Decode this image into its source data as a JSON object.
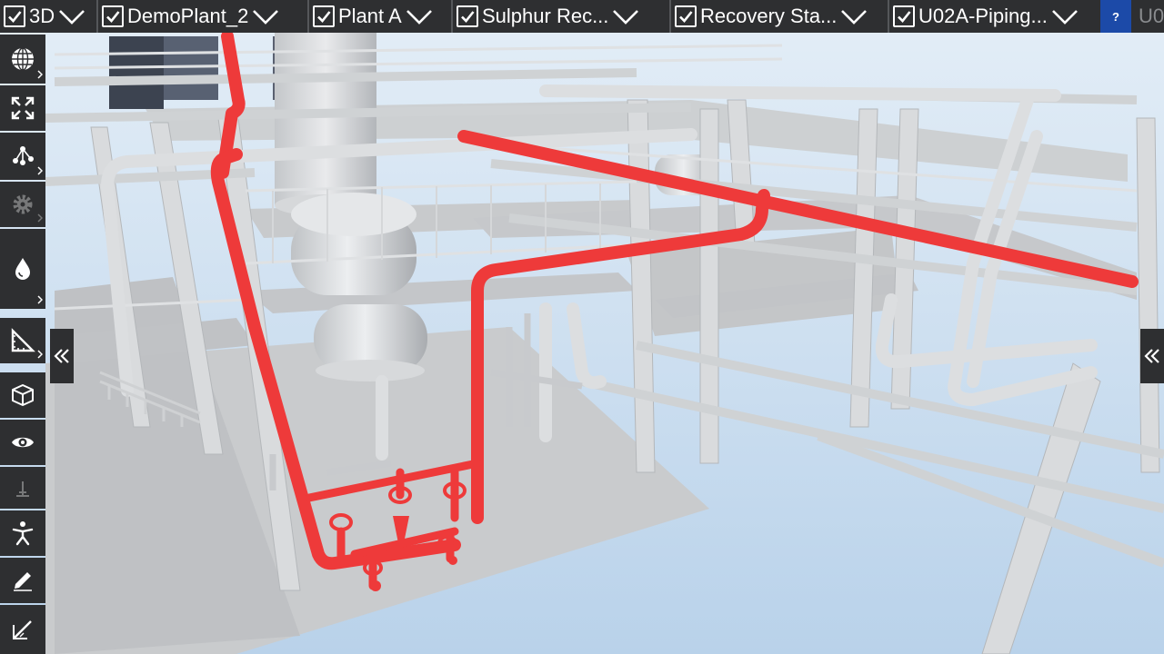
{
  "breadcrumbs": [
    {
      "label": "3D",
      "checked": true
    },
    {
      "label": "DemoPlant_2",
      "checked": true
    },
    {
      "label": "Plant A",
      "checked": true
    },
    {
      "label": "Sulphur Rec...",
      "checked": true
    },
    {
      "label": "Recovery Sta...",
      "checked": true
    },
    {
      "label": "U02A-Piping...",
      "checked": true
    }
  ],
  "breadcrumb_overflow": "U0",
  "help_label": "?",
  "toolbar": [
    {
      "name": "globe-icon",
      "has_submenu": true
    },
    {
      "name": "fit-view-icon",
      "has_submenu": false
    },
    {
      "name": "hierarchy-icon",
      "has_submenu": true
    },
    {
      "name": "settings-gear-icon",
      "has_submenu": true
    },
    {
      "name": "water-drop-icon",
      "has_submenu": true
    },
    {
      "name": "measure-ruler-icon",
      "has_submenu": true
    },
    {
      "name": "box-3d-icon",
      "has_submenu": false
    },
    {
      "name": "eye-icon",
      "has_submenu": false
    },
    {
      "name": "anchor-icon",
      "has_submenu": false
    },
    {
      "name": "walk-person-icon",
      "has_submenu": false
    },
    {
      "name": "pencil-icon",
      "has_submenu": false
    },
    {
      "name": "markup-tool-icon",
      "has_submenu": false
    }
  ],
  "colors": {
    "toolbar_bg": "#2e2f31",
    "highlight_pipe": "#ee3a3a",
    "structure": "#d2d4d6",
    "sky": "#d6e6f3",
    "help_button": "#1c4aa8"
  }
}
